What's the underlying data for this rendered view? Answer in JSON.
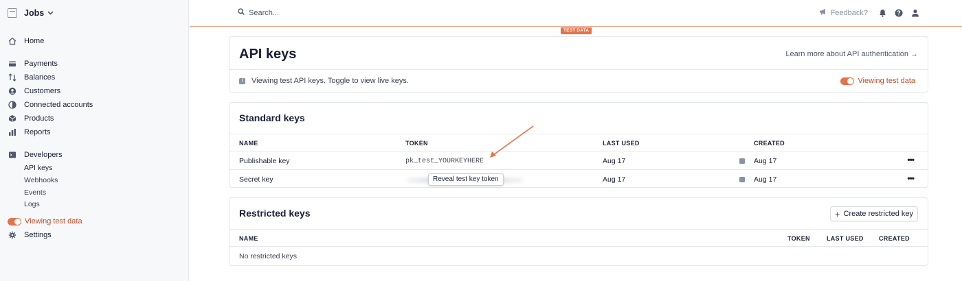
{
  "brand": {
    "name": "Jobs"
  },
  "sidebar": {
    "items": [
      {
        "label": "Home"
      },
      {
        "label": "Payments"
      },
      {
        "label": "Balances"
      },
      {
        "label": "Customers"
      },
      {
        "label": "Connected accounts"
      },
      {
        "label": "Products"
      },
      {
        "label": "Reports"
      },
      {
        "label": "Developers"
      }
    ],
    "developer_sub": [
      "API keys",
      "Webhooks",
      "Events",
      "Logs"
    ],
    "test_toggle_label": "Viewing test data",
    "settings": "Settings"
  },
  "topbar": {
    "search_placeholder": "Search...",
    "feedback": "Feedback?",
    "test_badge": "TEST DATA"
  },
  "api_keys_card": {
    "title": "API keys",
    "learn_more": "Learn more about API authentication →",
    "notice": "Viewing test API keys. Toggle to view live keys.",
    "toggle_label": "Viewing test data"
  },
  "standard_keys": {
    "title": "Standard keys",
    "columns": [
      "NAME",
      "TOKEN",
      "LAST USED",
      "CREATED"
    ],
    "rows": [
      {
        "name": "Publishable key",
        "token": "pk_test_YOURKEYHERE",
        "last_used": "Aug 17",
        "created": "Aug 17"
      },
      {
        "name": "Secret key",
        "token": "",
        "last_used": "Aug 17",
        "created": "Aug 17"
      }
    ],
    "reveal_tooltip": "Reveal test key token",
    "row_menu": "•••"
  },
  "restricted_keys": {
    "title": "Restricted keys",
    "create_button": "Create restricted key",
    "columns": [
      "NAME",
      "TOKEN",
      "LAST USED",
      "CREATED"
    ],
    "empty": "No restricted keys"
  },
  "colors": {
    "accent": "#e5724a",
    "accent_text": "#b8502a",
    "sidebar_bg": "#f7f8fa",
    "border": "#e3e8ee"
  },
  "icons": {
    "home": "home-icon",
    "payments": "payments-icon",
    "balances": "balances-icon",
    "customers": "customers-icon",
    "connected": "connected-accounts-icon",
    "products": "products-icon",
    "reports": "reports-icon",
    "developers": "developers-icon",
    "settings": "gear-icon",
    "search": "search-icon",
    "feedback": "megaphone-icon",
    "bell": "bell-icon",
    "help": "help-icon",
    "user": "user-icon"
  }
}
